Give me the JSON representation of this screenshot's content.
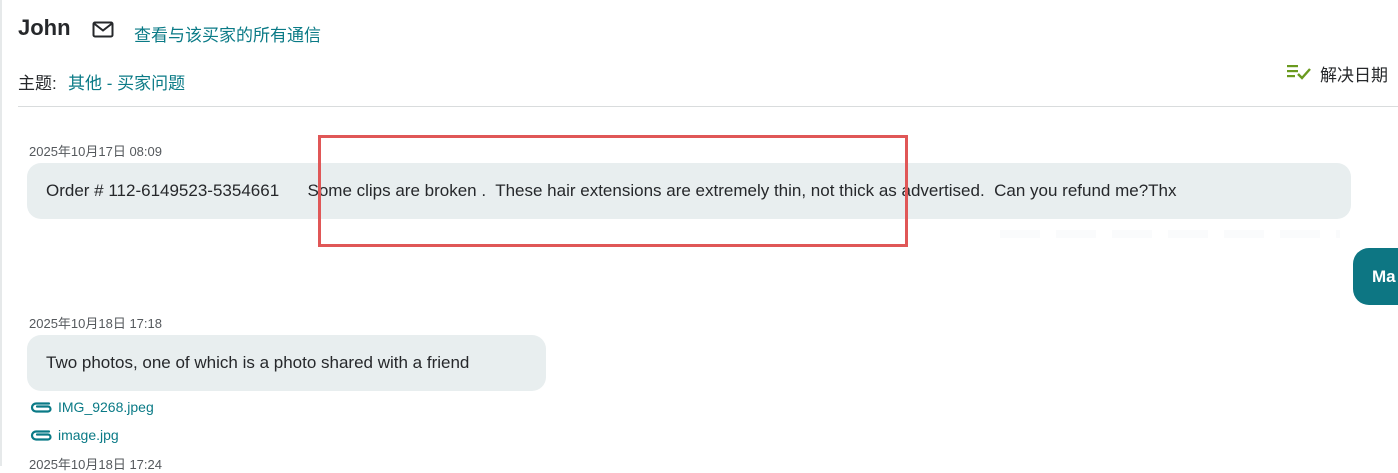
{
  "header": {
    "buyer_name": "John",
    "view_all_link": "查看与该买家的所有通信"
  },
  "subject": {
    "label": "主题:",
    "value": "其他 - 买家问题"
  },
  "resolve": {
    "label": "解决日期"
  },
  "messages": [
    {
      "timestamp": "2025年10月17日 08:09",
      "text": "Order # 112-6149523-5354661      Some clips are broken .  These hair extensions are extremely thin, not thick as advertised.  Can you refund me?Thx"
    },
    {
      "timestamp": "2025年10月18日 17:18",
      "text": "Two photos, one of which is a photo shared with a friend",
      "attachments": [
        "IMG_9268.jpeg",
        "image.jpg"
      ]
    },
    {
      "timestamp": "2025年10月18日 17:24"
    }
  ],
  "seller_reply": {
    "partial_text": "Ma"
  },
  "colors": {
    "accent": "#0a7a86",
    "seller_bubble": "#0d7683",
    "buyer_bubble": "#e8eeef",
    "highlight": "#e05757",
    "resolve_icon": "#6a9a1f"
  },
  "icons": {
    "mail": "mail-icon",
    "resolve": "checklist-icon",
    "attachment": "paperclip-icon"
  }
}
